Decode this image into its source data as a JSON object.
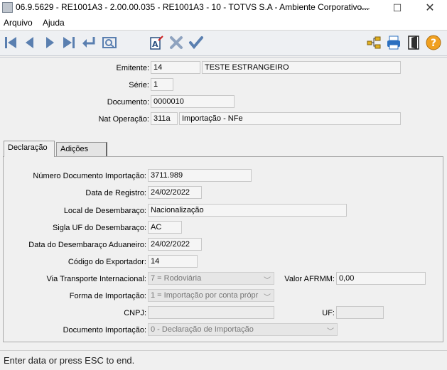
{
  "window": {
    "title": "06.9.5629 - RE1001A3 - 2.00.00.035 - RE1001A3 - 10 - TOTVS S.A - Ambiente Corporativo...",
    "minimize": "—",
    "maximize": "☐",
    "close": "✕"
  },
  "menu": {
    "items": [
      "Arquivo",
      "Ajuda"
    ]
  },
  "toolbar": {
    "left_icons": [
      "first-record-icon",
      "previous-record-icon",
      "next-record-icon",
      "last-record-icon",
      "goto-icon",
      "search-icon",
      "edit-icon",
      "delete-icon",
      "confirm-icon"
    ],
    "right_icons": [
      "tree-icon",
      "print-icon",
      "exit-icon",
      "help-icon"
    ]
  },
  "header": {
    "emitente_label": "Emitente:",
    "emitente_code": "14",
    "emitente_name": "TESTE ESTRANGEIRO",
    "serie_label": "Série:",
    "serie_value": "1",
    "documento_label": "Documento:",
    "documento_value": "0000010",
    "nat_label": "Nat Operação:",
    "nat_code": "311a",
    "nat_desc": "Importação - NFe"
  },
  "tabs": [
    {
      "label": "Declaração",
      "active": true
    },
    {
      "label": "Adições",
      "active": false
    }
  ],
  "form": {
    "num_doc_label": "Número Documento Importação:",
    "num_doc_value": "3711.989",
    "data_registro_label": "Data de Registro:",
    "data_registro_value": "24/02/2022",
    "local_label": "Local de Desembaraço:",
    "local_value": "Nacionalização",
    "sigla_label": "Sigla UF do Desembaraço:",
    "sigla_value": "AC",
    "data_desemb_label": "Data do Desembaraço Aduaneiro:",
    "data_desemb_value": "24/02/2022",
    "cod_export_label": "Código do Exportador:",
    "cod_export_value": "14",
    "via_label": "Via Transporte Internacional:",
    "via_value": "7 = Rodoviária",
    "afrmm_label": "Valor AFRMM:",
    "afrmm_value": "0,00",
    "forma_label": "Forma de Importação:",
    "forma_value": "1 = Importação por conta própr",
    "cnpj_label": "CNPJ:",
    "cnpj_value": "",
    "uf_label": "UF:",
    "uf_value": "",
    "doc_imp_label": "Documento Importação:",
    "doc_imp_value": "0 - Declaração de Importação"
  },
  "status": {
    "text": "Enter data or press ESC to end."
  },
  "colors": {
    "toolbar_blue": "#5a7fb0",
    "help_orange": "#f0a020",
    "edit_red": "#d02020",
    "print_blue": "#2a6fc0"
  }
}
